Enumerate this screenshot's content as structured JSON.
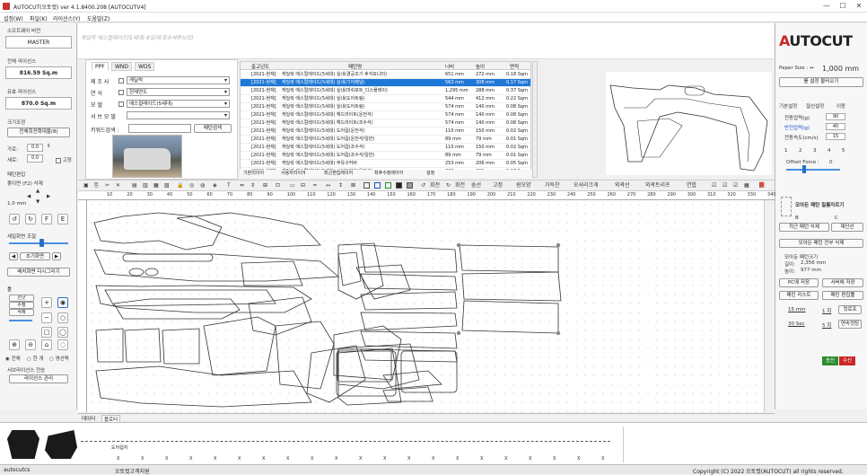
{
  "window": {
    "title": "AUTOCUT(오토컷) ver 4.1.8400.208 [AUTOCUTV4]",
    "min": "—",
    "max": "☐",
    "close": "✕"
  },
  "menu": [
    "설정(W)",
    "파일(K)",
    "라이선스(Y)",
    "도움말(Z)"
  ],
  "left": {
    "software_version_label": "소프트웨어 버전",
    "software_version": "MASTER",
    "total_license_label": "전체 라이선스",
    "total_license": "816.59 Sq.m",
    "remaining_license_label": "유효 라이선스",
    "remaining_license": "870.0 Sq.m",
    "size_adjust_label": "크기조정",
    "size_select": "전체회전확대율(8)",
    "width_label": "가로:",
    "width_value": "0.0",
    "height_label": "세로:",
    "height_value": "0.0",
    "fixed_label": "고정",
    "pattern_edit_label": "패턴편집",
    "nudge_label": "좋이면 (F2) 삭제",
    "step_value": "1.0 mm",
    "rotate_adjust_label": "세밀화면 조절",
    "reset_label": "초기화면",
    "redraw_label": "배치화면 다시그리기",
    "tools_label": "툴",
    "tool_modes": [
      "선긋",
      "수정",
      "삭제"
    ],
    "radio_all": "전체",
    "radio_one": "한 개",
    "radio_region": "영선택",
    "sub_license_label": "서브라이선스 전송",
    "license_manage": "라이선스 관리",
    "icons": [
      "plus-icon",
      "circle-icon",
      "rect-icon",
      "minus-icon"
    ]
  },
  "hint": "제일작 에스컬레이드(5세대) 8밀리(조수석투닝모)",
  "info": {
    "tabs": [
      "PPF",
      "WND",
      "WDS"
    ],
    "fields": [
      {
        "label": "제  조  사",
        "value": "캐딜락"
      },
      {
        "label": "연        식",
        "value": "현재연도"
      },
      {
        "label": "모        델",
        "value": "에스컬레이드(5세대)"
      },
      {
        "label": "서 브 모 델",
        "value": ""
      }
    ],
    "keyword_label": "키워드검색 :",
    "search_button": "패턴검색"
  },
  "grid": {
    "headers": [
      "출고년도",
      "패턴명",
      "너비",
      "높이",
      "면적"
    ],
    "rows": [
      [
        "[2021-현재]",
        "캐딜락 에스컬레이드(5세대) 실내(경공조기 후석모니터)",
        "651 mm",
        "272 mm",
        "0.18 Sqm"
      ],
      [
        "[2021-현재]",
        "캐딜락 에스컬레이드(5세대) 실내(기어패널)",
        "563 mm",
        "308 mm",
        "0.17 Sqm"
      ],
      [
        "[2021-현재]",
        "캐딜락 에스컬레이드(5세대) 실내(마쉬포트_디스플레이)",
        "1,295 mm",
        "288 mm",
        "0.37 Sqm"
      ],
      [
        "[2021-현재]",
        "캐딜락 에스컬레이드(5세대) 실내(도어트림)",
        "544 mm",
        "412 mm",
        "0.22 Sqm"
      ],
      [
        "[2021-현재]",
        "캐딜락 에스컬레이드(5세대) 실내(도어트림)",
        "574 mm",
        "140 mm",
        "0.08 Sqm"
      ],
      [
        "[2021-현재]",
        "캐딜락 에스컬레이드(5세대) 헤드라이트(운전석)",
        "574 mm",
        "140 mm",
        "0.08 Sqm"
      ],
      [
        "[2021-현재]",
        "캐딜락 에스컬레이드(5세대) 헤드라이트(조수석)",
        "574 mm",
        "140 mm",
        "0.08 Sqm"
      ],
      [
        "[2021-현재]",
        "캐딜락 에스컬레이드(5세대) 도어컵(운전석)",
        "110 mm",
        "150 mm",
        "0.02 Sqm"
      ],
      [
        "[2021-현재]",
        "캐딜락 에스컬레이드(5세대) 도어컵(운전석/일반)",
        "89 mm",
        "79 mm",
        "0.01 Sqm"
      ],
      [
        "[2021-현재]",
        "캐딜락 에스컬레이드(5세대) 도어컵(조수석)",
        "110 mm",
        "150 mm",
        "0.02 Sqm"
      ],
      [
        "[2021-현재]",
        "캐딜락 에스컬레이드(5세대) 도어컵(조수석/일반)",
        "89 mm",
        "79 mm",
        "0.01 Sqm"
      ],
      [
        "[2021-현재]",
        "캐딜락 에스컬레이드(5세대) 주유구커버",
        "253 mm",
        "206 mm",
        "0.05 Sqm"
      ],
      [
        "[2021-현재]",
        "캐딜락 에스컬레이드(5세대) 사이드미러(운전석)",
        "320 mm",
        "221 mm",
        "0.07 Sqm"
      ]
    ],
    "footer": [
      "기본리이어",
      "사용자리이어",
      "최근편집레이어",
      "최후수정레이어",
      "설정"
    ]
  },
  "right": {
    "logo_a": "A",
    "logo_rest": "UTOCUT",
    "paper_size_label": "Paper Size : ↔",
    "paper_size": "1,000 mm",
    "roll_button": "롤 설정 불러오기",
    "tabs": [
      "기본설정",
      "절선설정",
      "이동"
    ],
    "settings": [
      {
        "label": "전동압력(g)",
        "value": "90"
      },
      {
        "label": "반전압력(g)",
        "value": "40"
      },
      {
        "label": "전동속도(cm/s)",
        "value": "15"
      }
    ],
    "numbers": [
      "1",
      "2",
      "3",
      "4",
      "5"
    ],
    "offset_label": "Offset Force :",
    "offset_value": "0",
    "hide_label": "모아든 패턴 필름자르기",
    "b_label": "B",
    "c_label": "C",
    "recent_delete": "최근 패턴 삭제",
    "relocate": "재단선",
    "all_delete": "모아든 패턴 전부 삭제",
    "pattern_size_label": "모아둔 패턴크기",
    "pattern_w_label": "길이:",
    "pattern_w": "2,356 mm",
    "pattern_h_label": "높이:",
    "pattern_h": "977 mm",
    "save_pc": "PC에 저장",
    "save_server": "서버에 저장",
    "pattern_list": "패턴 리스트",
    "pattern_edit": "패턴 편집툴",
    "m15": "15 mm",
    "m1": "1 회",
    "cutline": "컷로프",
    "s30": "30 Sec",
    "m5": "5 회",
    "continue": "연속컷팅",
    "send": "송신",
    "receive": "수신"
  },
  "toolbar": {
    "items": [
      "회전",
      "회전",
      "숨선",
      "고정",
      "원모양",
      "가득찬",
      "모셔리크게",
      "외곽선",
      "외곽트리프",
      "연합"
    ]
  },
  "ruler": [
    "10",
    "20",
    "30",
    "40",
    "50",
    "60",
    "70",
    "80",
    "90",
    "100",
    "110",
    "120",
    "130",
    "140",
    "150",
    "160",
    "170",
    "180",
    "190",
    "200",
    "210",
    "220",
    "230",
    "240",
    "250",
    "260",
    "270",
    "280",
    "290",
    "300",
    "310",
    "320",
    "330",
    "340"
  ],
  "sheet_tabs": [
    "데이터",
    "플로터"
  ],
  "bottom": {
    "thumb_label": "도어컵지",
    "x_marks": "X"
  },
  "status": {
    "left": "autocutcs",
    "middle": "오토컷고객지원",
    "right": "Copyright (C) 2022 오토컷(AUTOCUT) all rights reserved."
  }
}
